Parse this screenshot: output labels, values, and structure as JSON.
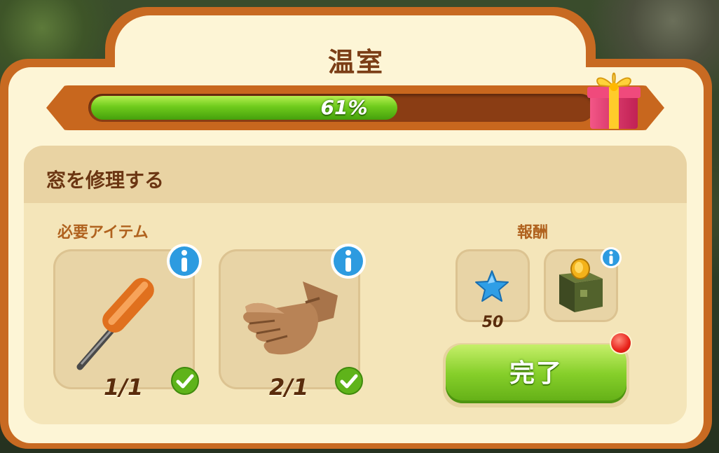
{
  "header": {
    "title": "温室"
  },
  "progress": {
    "percent": 61,
    "label": "61%"
  },
  "task": {
    "title": "窓を修理する"
  },
  "required": {
    "label": "必要アイテム",
    "items": [
      {
        "icon": "screwdriver-icon",
        "count": "1/1",
        "complete": true
      },
      {
        "icon": "glove-icon",
        "count": "2/1",
        "complete": true
      }
    ]
  },
  "rewards": {
    "label": "報酬",
    "items": [
      {
        "icon": "blue-star-icon",
        "amount": "50"
      },
      {
        "icon": "coin-box-icon"
      }
    ]
  },
  "complete_button": {
    "label": "完了"
  },
  "colors": {
    "accent": "#c86a22",
    "progress_green": "#6fcb1c",
    "button_green": "#86cf2a"
  }
}
